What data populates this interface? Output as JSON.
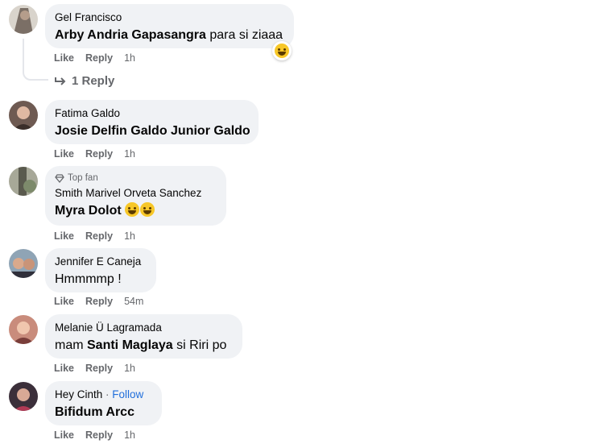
{
  "comments": [
    {
      "author": "Gel Francisco",
      "tag": "Arby Andria Gapasangra",
      "text": " para si ziaaa",
      "actions": {
        "like": "Like",
        "reply": "Reply",
        "time": "1h"
      },
      "reaction_icon": "laughing-emoji-icon",
      "replies_label": "1 Reply"
    },
    {
      "author": "Fatima Galdo",
      "tag": "Josie Delfin Galdo Junior Galdo",
      "text": "",
      "actions": {
        "like": "Like",
        "reply": "Reply",
        "time": "1h"
      }
    },
    {
      "badge": "Top fan",
      "author": "Smith Marivel Orveta Sanchez",
      "tag": "Myra Dolot",
      "text": "",
      "emojis": [
        "laughing-emoji-icon",
        "laughing-emoji-icon"
      ],
      "actions": {
        "like": "Like",
        "reply": "Reply",
        "time": "1h"
      }
    },
    {
      "author": "Jennifer E Caneja",
      "tag": "",
      "text": "Hmmmmp !",
      "actions": {
        "like": "Like",
        "reply": "Reply",
        "time": "54m"
      }
    },
    {
      "author": "Melanie Ü Lagramada",
      "prefix": "mam ",
      "tag": "Santi Maglaya",
      "text": " si Riri po",
      "actions": {
        "like": "Like",
        "reply": "Reply",
        "time": "1h"
      }
    },
    {
      "author": "Hey Cinth",
      "follow_sep": " · ",
      "follow": "Follow",
      "tag": "Bifidum Arcc",
      "text": "",
      "actions": {
        "like": "Like",
        "reply": "Reply",
        "time": "1h"
      }
    }
  ],
  "colors": {
    "bubble": "#f0f2f5",
    "meta": "#65676b",
    "link": "#216fdb"
  }
}
